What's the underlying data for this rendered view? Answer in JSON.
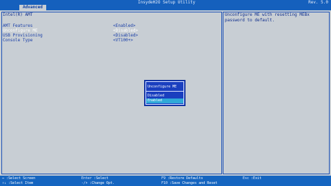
{
  "header": {
    "title": "InsydeH2O Setup Utility",
    "version": "Rev. 5.0"
  },
  "tabs": [
    {
      "label": "Advanced"
    }
  ],
  "section_title": "Intel(R) AMT",
  "settings": [
    {
      "label": "AMT Features",
      "value": "<Enabled>"
    },
    {
      "label": "Unconfigure ME",
      "value": "<Disabled>"
    },
    {
      "label": "USB Provisioning",
      "value": "<Disabled>"
    },
    {
      "label": "Console Type",
      "value": "<VT100+>"
    }
  ],
  "help": {
    "text": "Unconfigure ME with resetting MEBx password to default."
  },
  "popup": {
    "title": "Unconfigure ME",
    "options": [
      {
        "label": "Disabled"
      },
      {
        "label": "Enabled"
      }
    ]
  },
  "footer": {
    "items": [
      {
        "key": "↔",
        "action": ":Select Screen"
      },
      {
        "key": "↑↓",
        "action": ":Select Item"
      },
      {
        "key": "Enter",
        "action": ":Select"
      },
      {
        "key": "-/+",
        "action": ":Change Opt."
      },
      {
        "key": "F9",
        "action": ":Restore Defaults"
      },
      {
        "key": "F10",
        "action": ":Save Changes and Reset"
      },
      {
        "key": "Esc",
        "action": ":Exit"
      }
    ]
  }
}
